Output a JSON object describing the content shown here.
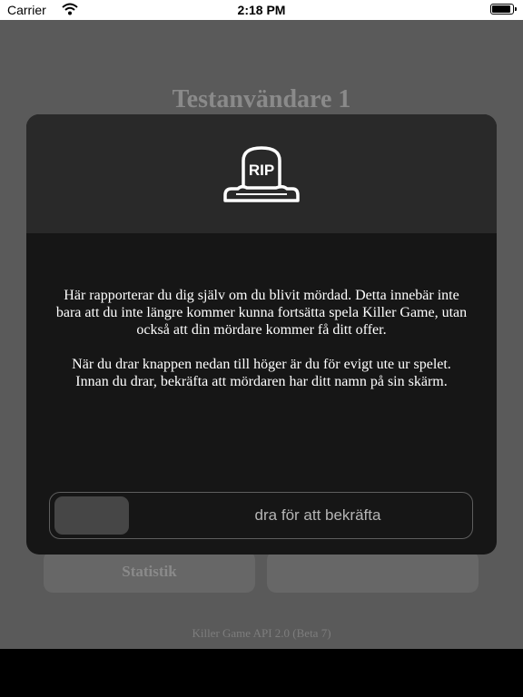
{
  "status_bar": {
    "carrier": "Carrier",
    "time": "2:18 PM"
  },
  "background": {
    "title": "Testanvändare 1",
    "buttons": [
      {
        "label": "Statistik"
      },
      {
        "label": ""
      }
    ],
    "footer": "Killer Game API 2.0 (Beta 7)"
  },
  "modal": {
    "icon_text": "RIP",
    "paragraph1": "Här rapporterar du dig själv om du blivit mördad. Detta innebär inte bara att du inte längre kommer kunna fortsätta spela Killer Game, utan också att din mördare kommer få ditt offer.",
    "paragraph2": "När du drar knappen nedan till höger är du för evigt ute ur spelet. Innan du drar, bekräfta att mördaren har ditt namn på sin skärm.",
    "slider_label": "dra för att bekräfta"
  }
}
